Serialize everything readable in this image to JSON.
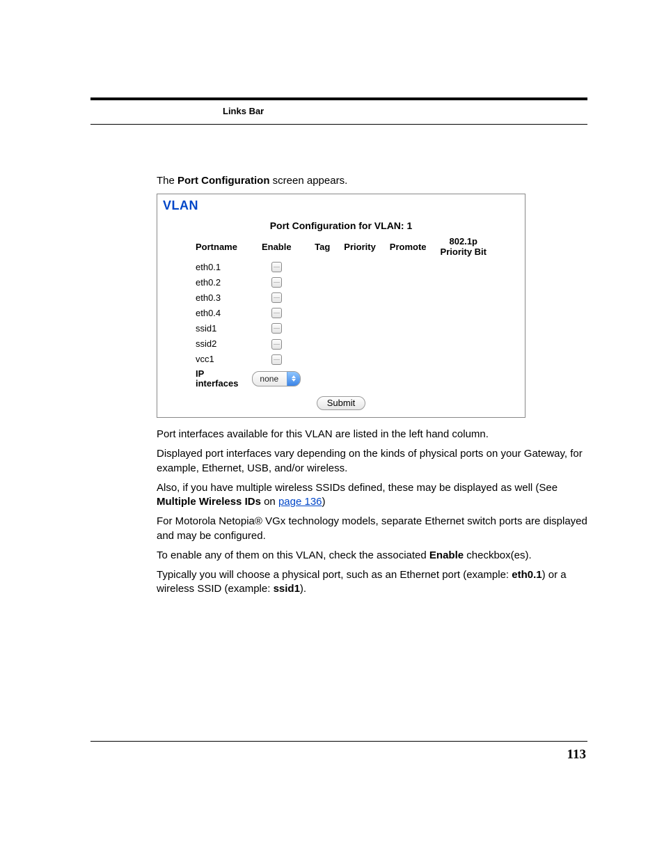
{
  "header": {
    "label": "Links Bar"
  },
  "intro": {
    "pre": "The ",
    "bold": "Port Configuration",
    "post": " screen appears."
  },
  "panel": {
    "title": "VLAN",
    "subtitle": "Port Configuration for VLAN: 1",
    "columns": {
      "portname": "Portname",
      "enable": "Enable",
      "tag": "Tag",
      "priority": "Priority",
      "promote": "Promote",
      "bit_l1": "802.1p",
      "bit_l2": "Priority Bit"
    },
    "rows": [
      {
        "name": "eth0.1"
      },
      {
        "name": "eth0.2"
      },
      {
        "name": "eth0.3"
      },
      {
        "name": "eth0.4"
      },
      {
        "name": "ssid1"
      },
      {
        "name": "ssid2"
      },
      {
        "name": "vcc1"
      }
    ],
    "ip_label_l1": "IP",
    "ip_label_l2": "interfaces",
    "ip_select_value": "none",
    "submit_label": "Submit"
  },
  "body": {
    "p1": "Port interfaces available for this VLAN are listed in the left hand column.",
    "p2": "Displayed port interfaces vary depending on the kinds of physical ports on your Gateway, for example, Ethernet, USB, and/or wireless.",
    "p3_pre": "Also, if you have multiple wireless SSIDs defined, these may be displayed as well (See ",
    "p3_bold": "Multiple Wireless IDs",
    "p3_mid": " on ",
    "p3_link": "page 136",
    "p3_post": ")",
    "p4": "For Motorola Netopia® VGx technology models, separate Ethernet switch ports are displayed and may be configured.",
    "p5_pre": "To enable any of them on this VLAN, check the associated ",
    "p5_bold": "Enable",
    "p5_post": " checkbox(es).",
    "p6_pre": "Typically you will choose a physical port, such as an Ethernet port (example: ",
    "p6_b1": "eth0.1",
    "p6_mid": ") or a wireless SSID (example: ",
    "p6_b2": "ssid1",
    "p6_post": ")."
  },
  "page_number": "113"
}
